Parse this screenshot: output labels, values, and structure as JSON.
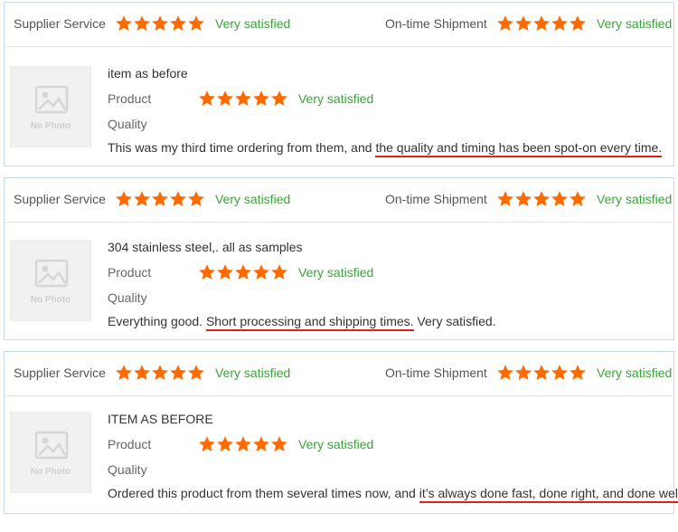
{
  "colors": {
    "star": "#ff6a00",
    "satisfied": "#3aa53a",
    "underline": "#e02020",
    "border": "#c9dbe9"
  },
  "reviews": [
    {
      "supplier_label": "Supplier Service",
      "supplier_rating": 5,
      "supplier_value": "Very satisfied",
      "shipment_label": "On-time Shipment",
      "shipment_rating": 5,
      "shipment_value": "Very satisfied",
      "photo_text": "No Photo",
      "item_title": "item as before",
      "product_label": "Product",
      "product_rating": 5,
      "product_value": "Very satisfied",
      "quality_label": "Quality",
      "comment_before": "This was my third time ordering from them, and ",
      "comment_highlight": "the quality and timing has been spot-on every time.",
      "comment_after": ""
    },
    {
      "supplier_label": "Supplier Service",
      "supplier_rating": 5,
      "supplier_value": "Very satisfied",
      "shipment_label": "On-time Shipment",
      "shipment_rating": 5,
      "shipment_value": "Very satisfied",
      "photo_text": "No Photo",
      "item_title": "304 stainless steel,. all as samples",
      "product_label": "Product",
      "product_rating": 5,
      "product_value": "Very satisfied",
      "quality_label": "Quality",
      "comment_before": "Everything good. ",
      "comment_highlight": "Short processing and shipping times.",
      "comment_after": " Very satisfied."
    },
    {
      "supplier_label": "Supplier Service",
      "supplier_rating": 5,
      "supplier_value": "Very satisfied",
      "shipment_label": "On-time Shipment",
      "shipment_rating": 5,
      "shipment_value": "Very satisfied",
      "photo_text": "No Photo",
      "item_title": "ITEM AS BEFORE",
      "product_label": "Product",
      "product_rating": 5,
      "product_value": "Very satisfied",
      "quality_label": "Quality",
      "comment_before": "Ordered this product from them several times now, and ",
      "comment_highlight": "it’s always done fast, done right, and done well.",
      "comment_after": ""
    }
  ]
}
